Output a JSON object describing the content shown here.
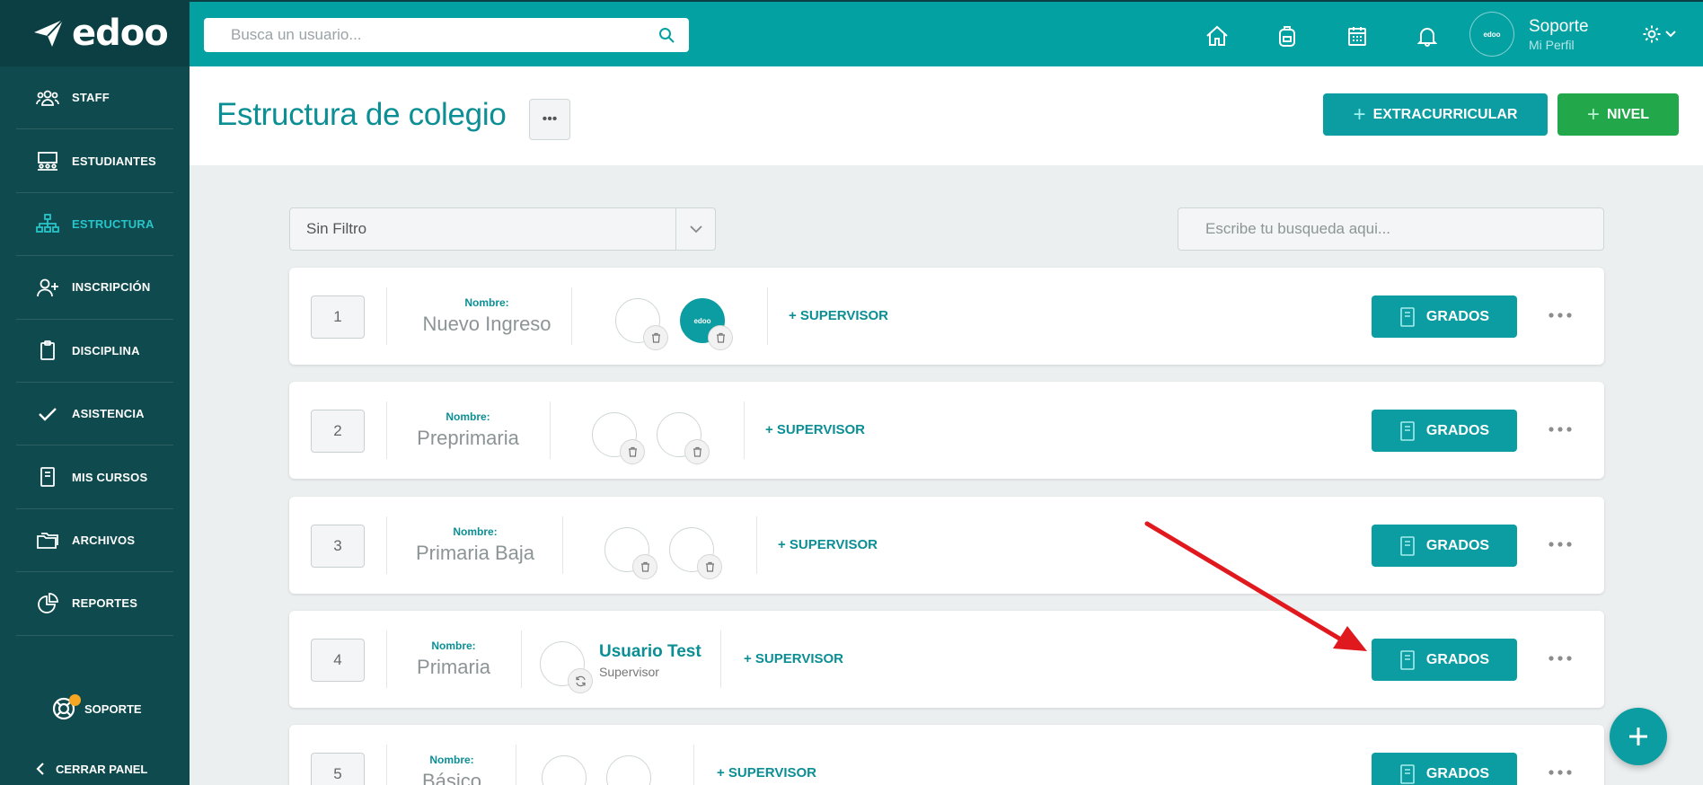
{
  "brand": {
    "name": "edoo"
  },
  "colors": {
    "primary": "#04a1a2",
    "sidebar": "#0e4a4e",
    "accent_green": "#22a84a",
    "active_nav": "#27c5c9",
    "annotation_red": "#e0191e"
  },
  "sidebar": {
    "items": [
      {
        "label": "STAFF",
        "icon": "users-icon"
      },
      {
        "label": "ESTUDIANTES",
        "icon": "classroom-icon"
      },
      {
        "label": "ESTRUCTURA",
        "icon": "hierarchy-icon",
        "active": true
      },
      {
        "label": "INSCRIPCIÓN",
        "icon": "user-plus-icon"
      },
      {
        "label": "DISCIPLINA",
        "icon": "clipboard-icon"
      },
      {
        "label": "ASISTENCIA",
        "icon": "check-icon"
      },
      {
        "label": "MIS CURSOS",
        "icon": "book-icon"
      },
      {
        "label": "ARCHIVOS",
        "icon": "folders-icon"
      },
      {
        "label": "REPORTES",
        "icon": "pie-chart-icon"
      }
    ],
    "support_label": "SOPORTE",
    "close_label": "CERRAR PANEL"
  },
  "topbar": {
    "search_placeholder": "Busca un usuario...",
    "profile_name": "Soporte",
    "profile_sub": "Mi Perfil",
    "avatar_text": "edoo"
  },
  "header": {
    "title": "Estructura de colegio",
    "btn_extracurricular": "EXTRACURRICULAR",
    "btn_nivel": "NIVEL"
  },
  "filters": {
    "select_value": "Sin Filtro",
    "query_placeholder": "Escribe tu busqueda aqui..."
  },
  "levels": [
    {
      "number": "1",
      "name_label": "Nombre:",
      "name": "Nuevo Ingreso",
      "add_supervisor": "+ SUPERVISOR",
      "grades_label": "GRADOS"
    },
    {
      "number": "2",
      "name_label": "Nombre:",
      "name": "Preprimaria",
      "add_supervisor": "+ SUPERVISOR",
      "grades_label": "GRADOS"
    },
    {
      "number": "3",
      "name_label": "Nombre:",
      "name": "Primaria Baja",
      "add_supervisor": "+ SUPERVISOR",
      "grades_label": "GRADOS"
    },
    {
      "number": "4",
      "name_label": "Nombre:",
      "name": "Primaria",
      "supervisor_name": "Usuario Test",
      "supervisor_role": "Supervisor",
      "add_supervisor": "+ SUPERVISOR",
      "grades_label": "GRADOS"
    },
    {
      "number": "5",
      "name_label": "Nombre:",
      "name": "Básico",
      "add_supervisor": "+ SUPERVISOR",
      "grades_label": "GRADOS"
    }
  ]
}
